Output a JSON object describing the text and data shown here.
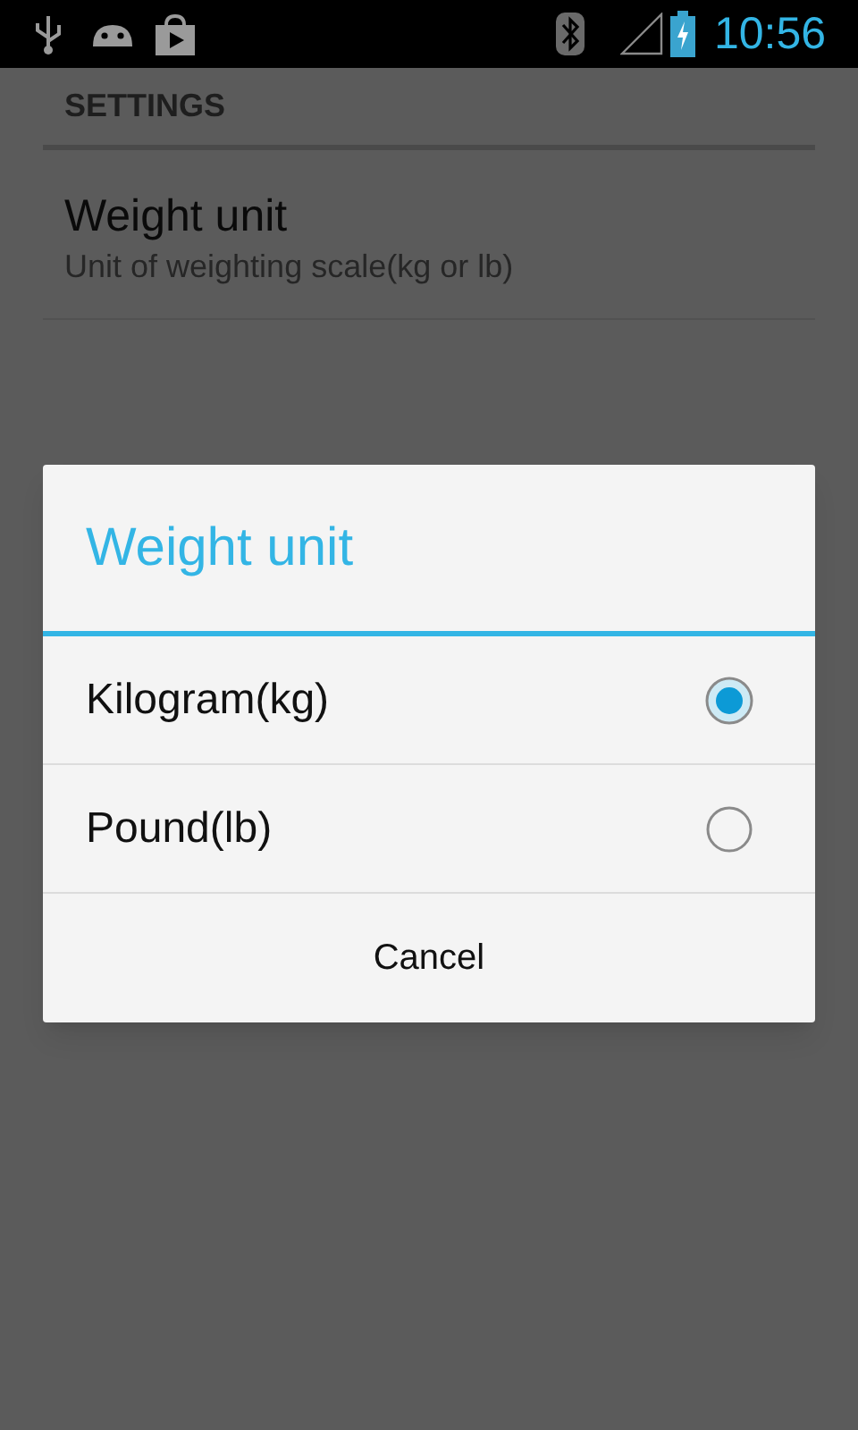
{
  "status_bar": {
    "time": "10:56"
  },
  "settings": {
    "header": "SETTINGS",
    "items": [
      {
        "title": "Weight unit",
        "summary": "Unit of weighting scale(kg or lb)"
      }
    ]
  },
  "dialog": {
    "title": "Weight unit",
    "options": [
      {
        "label": "Kilogram(kg)",
        "selected": true
      },
      {
        "label": "Pound(lb)",
        "selected": false
      }
    ],
    "cancel": "Cancel"
  }
}
